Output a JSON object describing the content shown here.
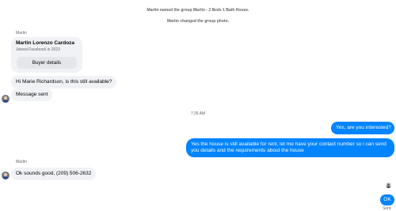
{
  "system_messages": [
    "Martin named the group Martin - 2 Beds 1 Bath House.",
    "Martin changed the group photo."
  ],
  "thread": {
    "sender_name": "Martin",
    "card": {
      "name": "Martin Lorenzo Cardoza",
      "subtitle": "Joined Facebook in 2023",
      "button_label": "Buyer details"
    },
    "incoming_1": "Hi Marie Richardson, is this still available?",
    "incoming_2": "Message sent",
    "timestamp": "7:26 AM",
    "outgoing_1": "Yes, are you interested?",
    "outgoing_2_line1": "Yes the house is still available for rent, let me have your contact number so i can send",
    "outgoing_2_line2": "you details and the requirements about the house",
    "sender_name_2": "Martin",
    "incoming_3": "Ok sounds good, (209) 506-2632",
    "outgoing_3": "OK",
    "status": "Sent"
  },
  "colors": {
    "outgoing_bubble": "#0084ff",
    "incoming_bubble": "#f0f2f5",
    "meta_text": "#65676b"
  },
  "icons": [
    "avatar-icon",
    "seen-avatar-icon"
  ]
}
